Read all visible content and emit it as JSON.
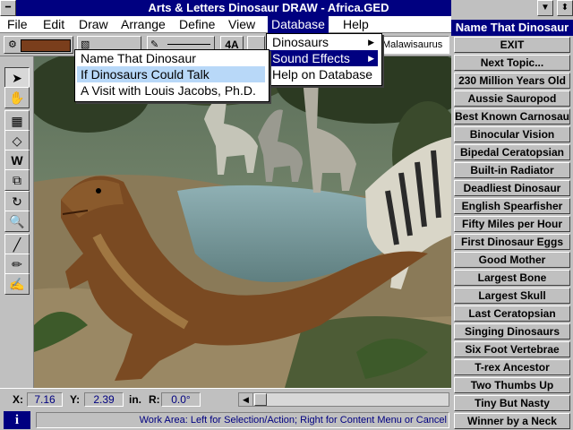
{
  "window": {
    "title": "Arts & Letters Dinosaur DRAW - Africa.GED",
    "minimize_glyph": "▼",
    "scroll_glyph": "⬍"
  },
  "menubar": {
    "items": [
      "File",
      "Edit",
      "Draw",
      "Arrange",
      "Define",
      "View",
      "Database",
      "Help"
    ],
    "active": "Database"
  },
  "toolbar": {
    "font_size_label": "4A",
    "name_field": "Malawisaurus"
  },
  "database_menu": {
    "items": [
      {
        "label": "Dinosaurs",
        "submenu": true
      },
      {
        "label": "Sound Effects",
        "submenu": true
      },
      {
        "label": "Help on Database",
        "submenu": false
      }
    ],
    "highlighted": "Sound Effects"
  },
  "sound_submenu": {
    "items": [
      "Name That Dinosaur",
      "If Dinosaurs Could Talk",
      "A Visit with Louis Jacobs, Ph.D."
    ],
    "highlighted": "If Dinosaurs Could Talk"
  },
  "panel": {
    "title": "Name That Dinosaur",
    "buttons": [
      "EXIT",
      "Next Topic...",
      "230 Million Years Old",
      "Aussie Sauropod",
      "Best Known Carnosaur",
      "Binocular Vision",
      "Bipedal Ceratopsian",
      "Built-in Radiator",
      "Deadliest Dinosaur",
      "English Spearfisher",
      "Fifty Miles per Hour",
      "First Dinosaur Eggs",
      "Good Mother",
      "Largest Bone",
      "Largest Skull",
      "Last Ceratopsian",
      "Singing Dinosaurs",
      "Six Foot Vertebrae",
      "T-rex Ancestor",
      "Two Thumbs Up",
      "Tiny But Nasty",
      "Winner by a Neck"
    ]
  },
  "coords": {
    "x_label": "X:",
    "x_value": "7.16",
    "y_label": "Y:",
    "y_value": "2.39",
    "unit": "in.",
    "r_label": "R:",
    "r_value": "0.0°"
  },
  "status": {
    "text": "Work Area: Left for Selection/Action; Right for Content Menu or Cancel",
    "info_icon": "i"
  },
  "colors": {
    "title_bar": "#000080",
    "highlight": "#000080",
    "fill_swatch": "#7a3e1c"
  }
}
